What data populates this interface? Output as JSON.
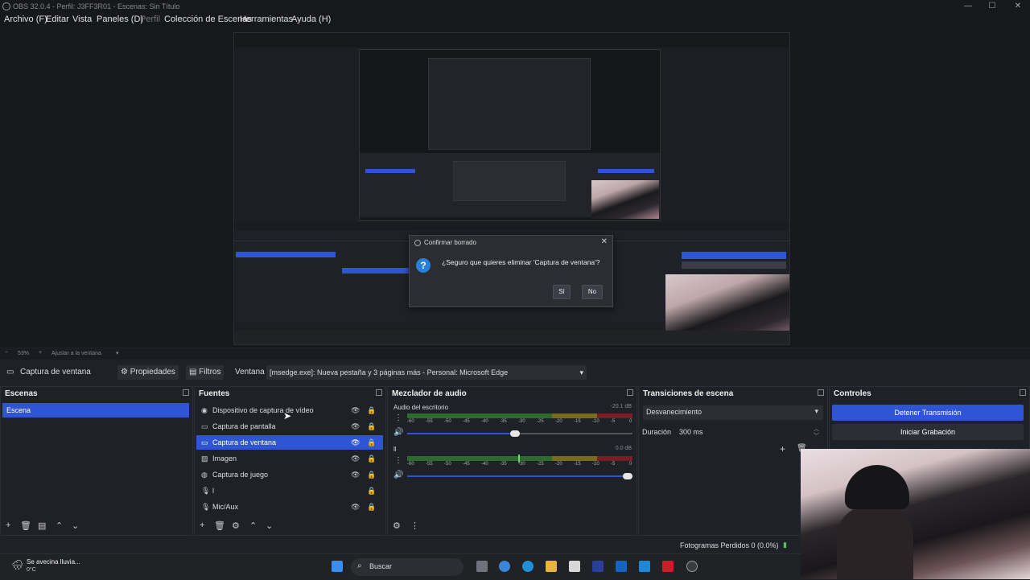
{
  "window": {
    "title": "OBS 32.0.4 - Perfil: J3FF3R01 - Escenas: Sin Título"
  },
  "menu": [
    "Archivo (F)",
    "Editar",
    "Vista",
    "Paneles (D)",
    "Perfil",
    "Colección de Escenas",
    "Herramientas",
    "Ayuda (H)"
  ],
  "dialog": {
    "title": "Confirmar borrado",
    "message": "¿Seguro que quieres eliminar 'Captura de ventana'?",
    "yes": "Sí",
    "no": "No",
    "close": "✕"
  },
  "zoom": {
    "level": "53%",
    "mode": "Ajustar a la ventana"
  },
  "source_toolbar": {
    "selected": "Captura de ventana",
    "properties": "Propiedades",
    "filters": "Filtros",
    "window_label": "Ventana",
    "window_value": "[msedge.exe]: Nueva pestaña y 3 páginas más - Personal: Microsoft Edge"
  },
  "scenes": {
    "title": "Escenas",
    "items": [
      "Escena"
    ]
  },
  "sources": {
    "title": "Fuentes",
    "items": [
      "Dispositivo de captura de vídeo",
      "Captura de pantalla",
      "Captura de ventana",
      "Imagen",
      "Captura de juego",
      "l",
      "Mic/Aux"
    ]
  },
  "mixer": {
    "title": "Mezclador de audio",
    "channels": [
      {
        "name": "Audio del escritorio",
        "db": "-20.1 dB"
      },
      {
        "name": "ll",
        "db": "0.0 dB"
      }
    ],
    "scale": [
      "-60",
      "-55",
      "-50",
      "-45",
      "-40",
      "-35",
      "-30",
      "-25",
      "-20",
      "-15",
      "-10",
      "-5",
      "0"
    ]
  },
  "transitions": {
    "title": "Transiciones de escena",
    "type": "Desvanecimiento",
    "duration_label": "Duración",
    "duration_value": "300 ms"
  },
  "controls": {
    "title": "Controles",
    "stop_stream": "Detener Transmisión",
    "start_record": "Iniciar Grabación"
  },
  "status": {
    "dropped_frames": "Fotogramas Perdidos 0 (0.0%)"
  },
  "taskbar": {
    "weather": "Se avecina lluvia...",
    "temp": "0°C",
    "search": "Buscar"
  },
  "colors": {
    "accent": "#2f55d4",
    "bg": "#1f2128"
  }
}
